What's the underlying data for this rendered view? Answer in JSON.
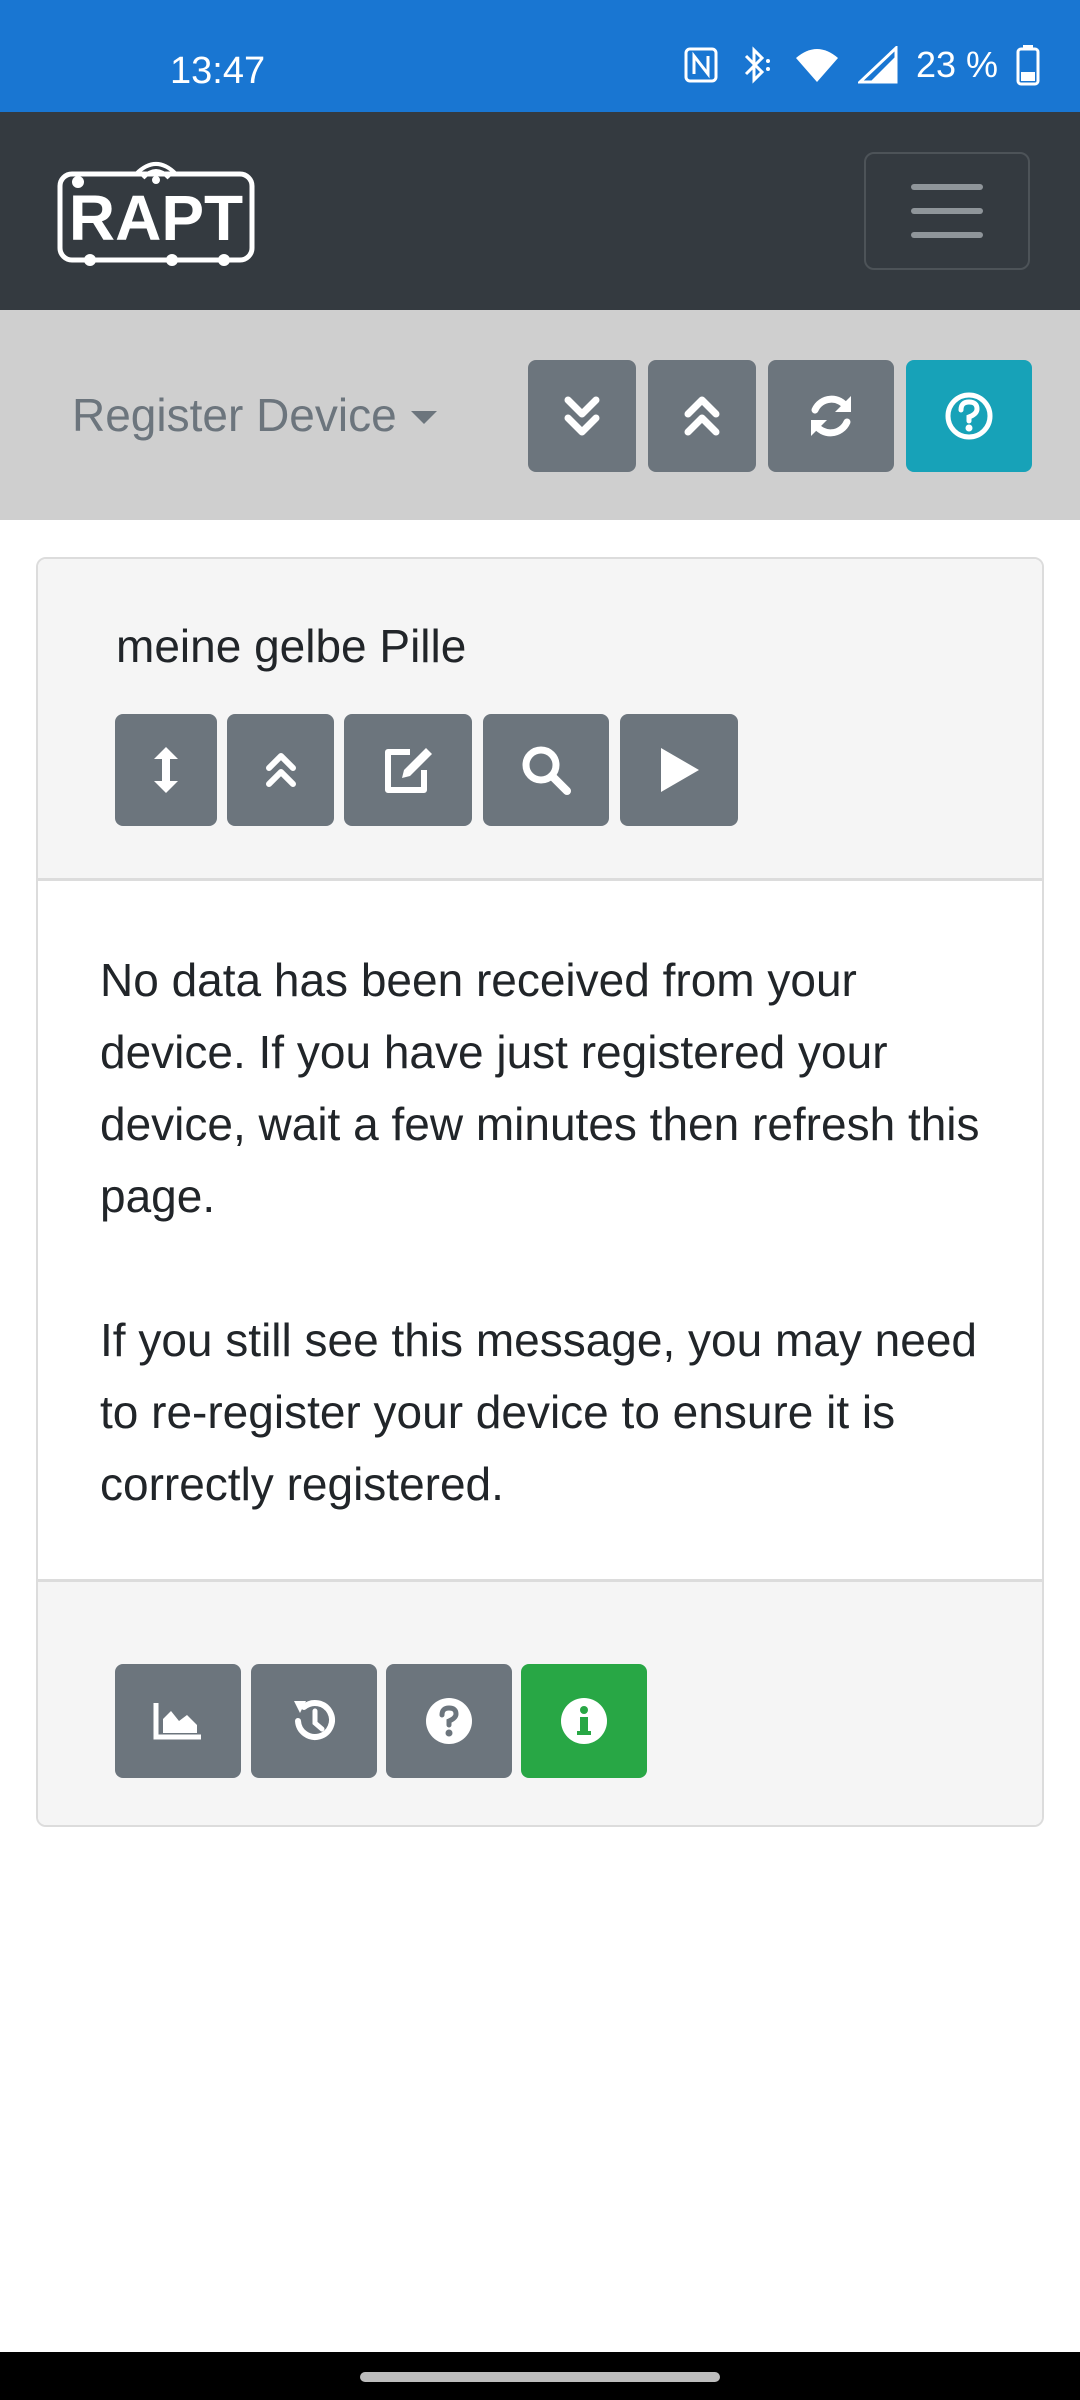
{
  "status_bar": {
    "time": "13:47",
    "battery": "23 %",
    "icons": [
      "nfc-icon",
      "bluetooth-icon",
      "wifi-icon",
      "cellular-signal-icon",
      "battery-icon"
    ]
  },
  "navbar": {
    "logo_text": "RAPT",
    "menu_icon": "hamburger-menu-icon"
  },
  "toolbar": {
    "dropdown_label": "Register Device",
    "buttons": [
      {
        "icon": "double-chevron-down-icon"
      },
      {
        "icon": "double-chevron-up-icon"
      },
      {
        "icon": "refresh-icon"
      },
      {
        "icon": "help-circle-icon"
      }
    ]
  },
  "card": {
    "device_name": "meine gelbe Pille",
    "header_buttons": [
      {
        "icon": "vertical-arrows-icon"
      },
      {
        "icon": "double-chevron-up-icon"
      },
      {
        "icon": "edit-icon"
      },
      {
        "icon": "search-icon"
      },
      {
        "icon": "play-icon"
      }
    ],
    "message_1": "No data has been received from your device. If you have just registered your device, wait a few minutes then refresh this page.",
    "message_2": "If you still see this message, you may need to re-register your device to ensure it is correctly registered.",
    "footer_buttons": [
      {
        "icon": "area-chart-icon"
      },
      {
        "icon": "history-icon"
      },
      {
        "icon": "question-circle-icon"
      },
      {
        "icon": "info-circle-icon"
      }
    ]
  },
  "colors": {
    "status_bar": "#1976d2",
    "navbar": "#343a40",
    "toolbar": "#cfcfcf",
    "button_secondary": "#6c757d",
    "button_info": "#17a2b8",
    "button_success": "#28a745"
  }
}
